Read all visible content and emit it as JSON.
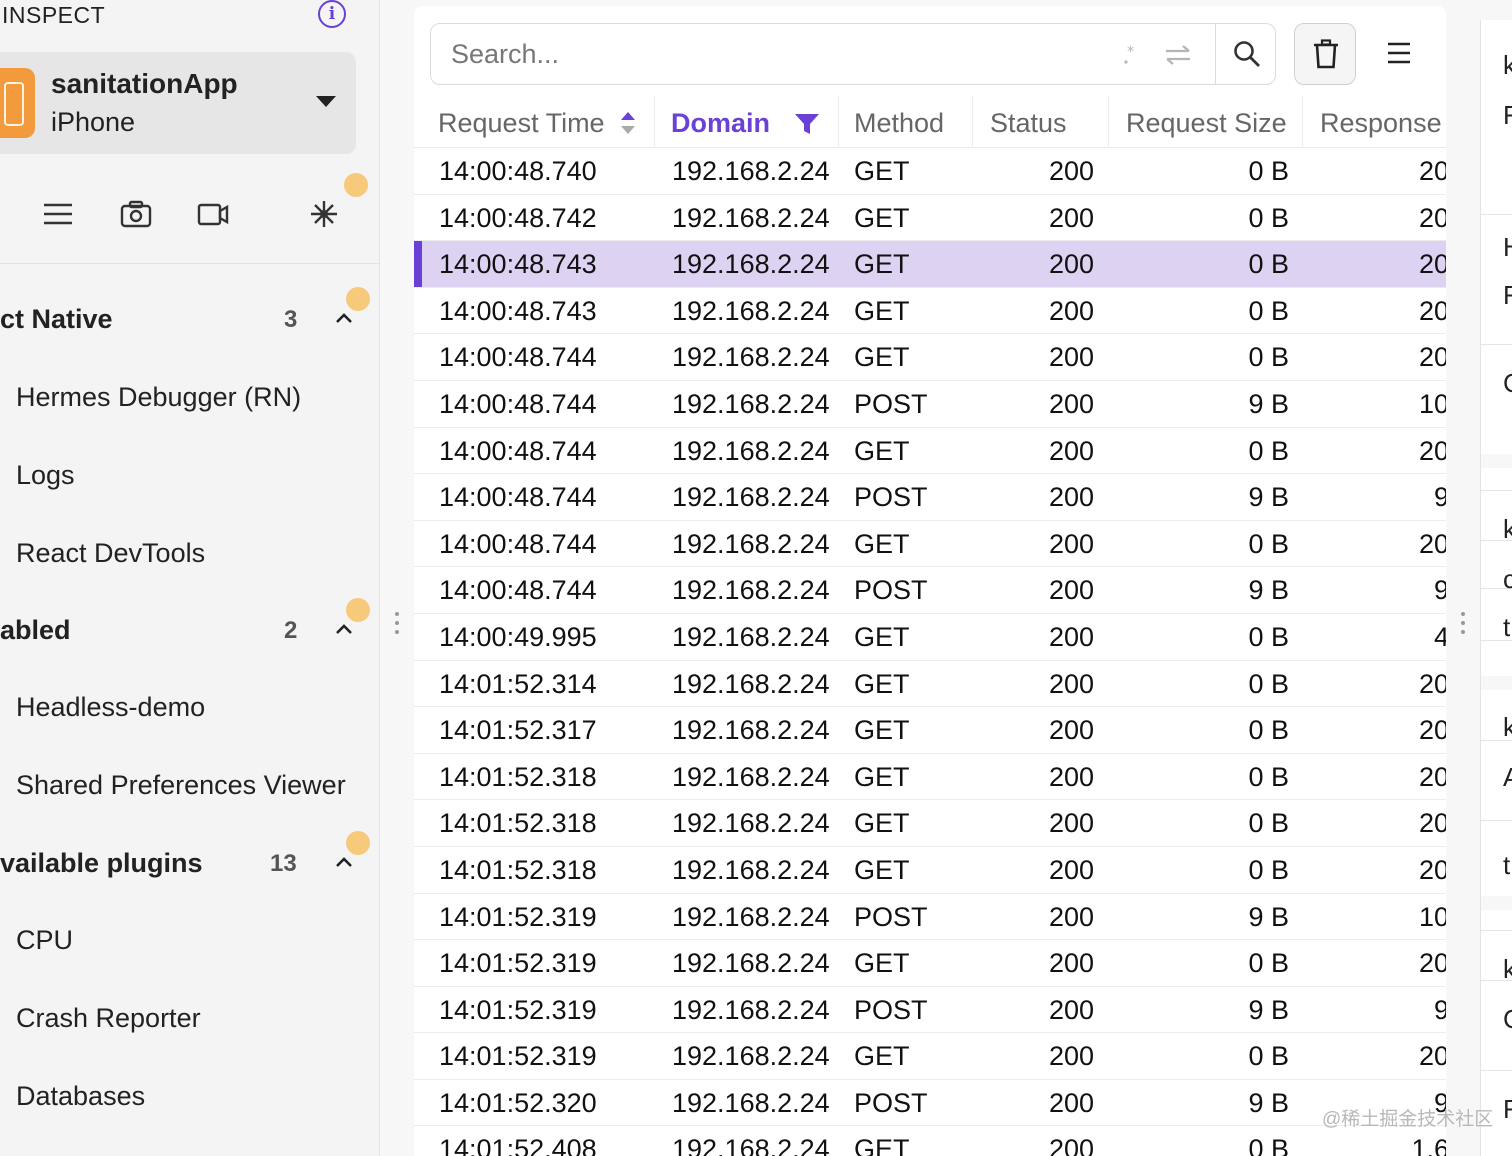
{
  "sidebar": {
    "inspect_label": "INSPECT",
    "device": {
      "app": "sanitationApp",
      "type": "iPhone"
    },
    "sections": [
      {
        "title": "ct Native",
        "count": "3",
        "items": [
          "Hermes Debugger (RN)",
          "Logs",
          "React DevTools"
        ]
      },
      {
        "title": "abled",
        "count": "2",
        "items": [
          "Headless-demo",
          "Shared Preferences Viewer"
        ]
      },
      {
        "title": "vailable plugins",
        "count": "13",
        "items": [
          "CPU",
          "Crash Reporter",
          "Databases"
        ]
      }
    ]
  },
  "main": {
    "search": {
      "placeholder": "Search..."
    },
    "columns": {
      "time": "Request Time",
      "domain": "Domain",
      "method": "Method",
      "status": "Status",
      "reqsize": "Request Size",
      "response": "Response"
    },
    "selected_row_index": 2,
    "rows": [
      {
        "time": "14:00:48.740",
        "domain": "192.168.2.24",
        "method": "GET",
        "status": "200",
        "reqsize": "0 B",
        "resp": "20"
      },
      {
        "time": "14:00:48.742",
        "domain": "192.168.2.24",
        "method": "GET",
        "status": "200",
        "reqsize": "0 B",
        "resp": "20"
      },
      {
        "time": "14:00:48.743",
        "domain": "192.168.2.24",
        "method": "GET",
        "status": "200",
        "reqsize": "0 B",
        "resp": "20"
      },
      {
        "time": "14:00:48.743",
        "domain": "192.168.2.24",
        "method": "GET",
        "status": "200",
        "reqsize": "0 B",
        "resp": "20"
      },
      {
        "time": "14:00:48.744",
        "domain": "192.168.2.24",
        "method": "GET",
        "status": "200",
        "reqsize": "0 B",
        "resp": "20"
      },
      {
        "time": "14:00:48.744",
        "domain": "192.168.2.24",
        "method": "POST",
        "status": "200",
        "reqsize": "9 B",
        "resp": "10"
      },
      {
        "time": "14:00:48.744",
        "domain": "192.168.2.24",
        "method": "GET",
        "status": "200",
        "reqsize": "0 B",
        "resp": "20"
      },
      {
        "time": "14:00:48.744",
        "domain": "192.168.2.24",
        "method": "POST",
        "status": "200",
        "reqsize": "9 B",
        "resp": "9"
      },
      {
        "time": "14:00:48.744",
        "domain": "192.168.2.24",
        "method": "GET",
        "status": "200",
        "reqsize": "0 B",
        "resp": "20"
      },
      {
        "time": "14:00:48.744",
        "domain": "192.168.2.24",
        "method": "POST",
        "status": "200",
        "reqsize": "9 B",
        "resp": "9"
      },
      {
        "time": "14:00:49.995",
        "domain": "192.168.2.24",
        "method": "GET",
        "status": "200",
        "reqsize": "0 B",
        "resp": "4"
      },
      {
        "time": "14:01:52.314",
        "domain": "192.168.2.24",
        "method": "GET",
        "status": "200",
        "reqsize": "0 B",
        "resp": "20"
      },
      {
        "time": "14:01:52.317",
        "domain": "192.168.2.24",
        "method": "GET",
        "status": "200",
        "reqsize": "0 B",
        "resp": "20"
      },
      {
        "time": "14:01:52.318",
        "domain": "192.168.2.24",
        "method": "GET",
        "status": "200",
        "reqsize": "0 B",
        "resp": "20"
      },
      {
        "time": "14:01:52.318",
        "domain": "192.168.2.24",
        "method": "GET",
        "status": "200",
        "reqsize": "0 B",
        "resp": "20"
      },
      {
        "time": "14:01:52.318",
        "domain": "192.168.2.24",
        "method": "GET",
        "status": "200",
        "reqsize": "0 B",
        "resp": "20"
      },
      {
        "time": "14:01:52.319",
        "domain": "192.168.2.24",
        "method": "POST",
        "status": "200",
        "reqsize": "9 B",
        "resp": "10"
      },
      {
        "time": "14:01:52.319",
        "domain": "192.168.2.24",
        "method": "GET",
        "status": "200",
        "reqsize": "0 B",
        "resp": "20"
      },
      {
        "time": "14:01:52.319",
        "domain": "192.168.2.24",
        "method": "POST",
        "status": "200",
        "reqsize": "9 B",
        "resp": "9"
      },
      {
        "time": "14:01:52.319",
        "domain": "192.168.2.24",
        "method": "GET",
        "status": "200",
        "reqsize": "0 B",
        "resp": "20"
      },
      {
        "time": "14:01:52.320",
        "domain": "192.168.2.24",
        "method": "POST",
        "status": "200",
        "reqsize": "9 B",
        "resp": "9"
      },
      {
        "time": "14:01:52.408",
        "domain": "192.168.2.24",
        "method": "GET",
        "status": "200",
        "reqsize": "0 B",
        "resp": "1.6"
      }
    ]
  },
  "right_panel": {
    "clipped_chars": [
      "k",
      "F",
      "H",
      "F",
      "C",
      "k",
      "c",
      "t",
      "k",
      "A",
      "t",
      "k",
      "C",
      "F"
    ]
  },
  "watermark": "@稀土掘金技术社区",
  "colors": {
    "accent": "#6a40d6",
    "selected_row": "#ddd2f2",
    "device_icon": "#f39a3c",
    "badge_dot": "#f7c97a"
  }
}
